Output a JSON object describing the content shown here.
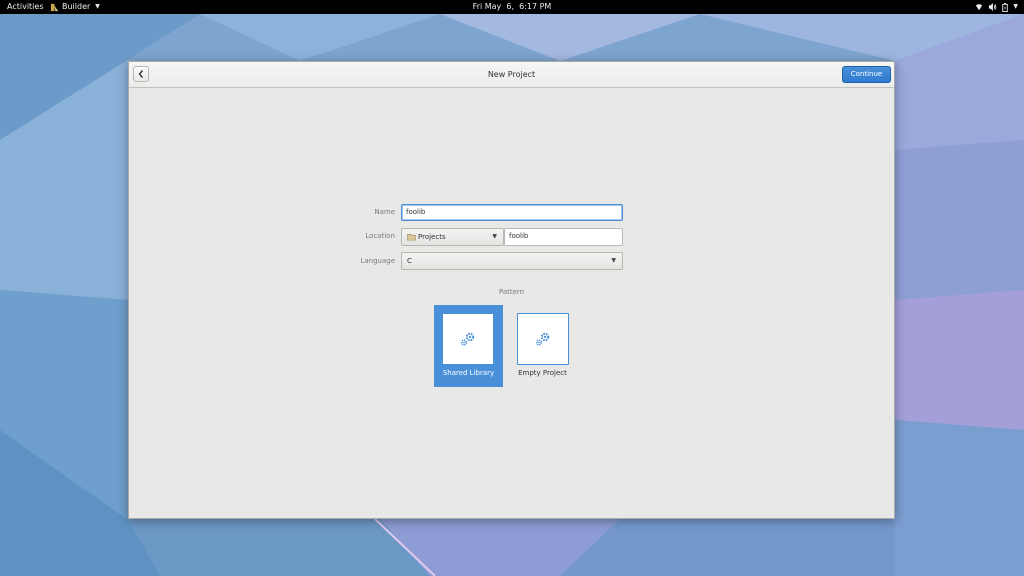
{
  "topbar": {
    "activities": "Activities",
    "app_name": "Builder",
    "clock": "Fri May  6,  6:17 PM",
    "status_icons": [
      "network-icon",
      "volume-icon",
      "battery-icon",
      "system-menu-caret-icon"
    ]
  },
  "window": {
    "title": "New Project",
    "continue_label": "Continue",
    "form": {
      "name_label": "Name",
      "name_value": "foolib",
      "location_label": "Location",
      "location_folder": "Projects",
      "location_value": "foolib",
      "language_label": "Language",
      "language_value": "C"
    },
    "pattern": {
      "label": "Pattern",
      "templates": [
        {
          "label": "Shared Library",
          "selected": true,
          "icon": "gears-icon"
        },
        {
          "label": "Empty Project",
          "selected": false,
          "icon": "gears-icon"
        }
      ]
    }
  },
  "colors": {
    "accent": "#4a90d9",
    "topbar": "#000000",
    "window_bg": "#e8e8e7"
  }
}
